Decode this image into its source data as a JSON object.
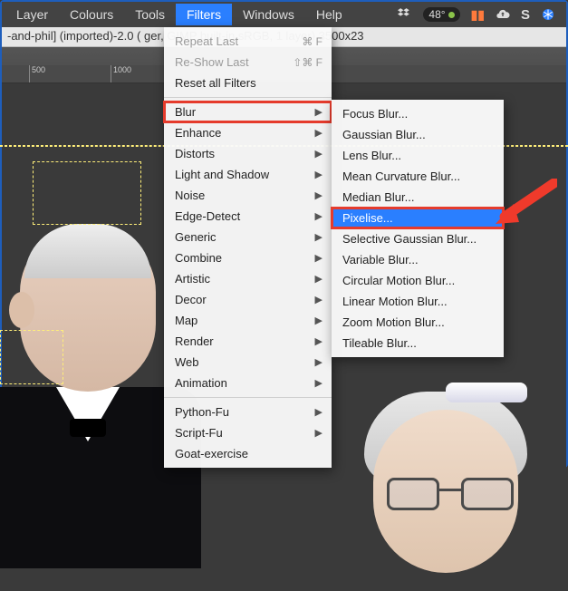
{
  "menubar": {
    "items": [
      "Layer",
      "Colours",
      "Tools",
      "Filters",
      "Windows",
      "Help"
    ],
    "active_index": 3
  },
  "tray": {
    "temp": "48°",
    "icons": [
      "dropbox-icon",
      "pause-icon",
      "cloud-upload-icon",
      "s-icon",
      "snowflake-icon"
    ]
  },
  "titlebar": "-and-phil] (imported)-2.0 (     ger, GIMP built-in sRGB, 1 layer) 3500x23",
  "ruler": {
    "marks": [
      "500",
      "1000"
    ]
  },
  "filters_menu": {
    "groups": [
      [
        {
          "label": "Repeat Last",
          "kb": "⌘ F",
          "disabled": true
        },
        {
          "label": "Re-Show Last",
          "kb": "⇧⌘ F",
          "disabled": true
        },
        {
          "label": "Reset all Filters"
        }
      ],
      [
        {
          "label": "Blur",
          "sub": true,
          "highlight": true
        },
        {
          "label": "Enhance",
          "sub": true
        },
        {
          "label": "Distorts",
          "sub": true
        },
        {
          "label": "Light and Shadow",
          "sub": true
        },
        {
          "label": "Noise",
          "sub": true
        },
        {
          "label": "Edge-Detect",
          "sub": true
        },
        {
          "label": "Generic",
          "sub": true
        },
        {
          "label": "Combine",
          "sub": true
        },
        {
          "label": "Artistic",
          "sub": true
        },
        {
          "label": "Decor",
          "sub": true
        },
        {
          "label": "Map",
          "sub": true
        },
        {
          "label": "Render",
          "sub": true
        },
        {
          "label": "Web",
          "sub": true
        },
        {
          "label": "Animation",
          "sub": true
        }
      ],
      [
        {
          "label": "Python-Fu",
          "sub": true
        },
        {
          "label": "Script-Fu",
          "sub": true
        },
        {
          "label": "Goat-exercise"
        }
      ]
    ]
  },
  "blur_submenu": {
    "items": [
      "Focus Blur...",
      "Gaussian Blur...",
      "Lens Blur...",
      "Mean Curvature Blur...",
      "Median Blur...",
      "Pixelise...",
      "Selective Gaussian Blur...",
      "Variable Blur...",
      "Circular Motion Blur...",
      "Linear Motion Blur...",
      "Zoom Motion Blur...",
      "Tileable Blur..."
    ],
    "selected_index": 5
  }
}
